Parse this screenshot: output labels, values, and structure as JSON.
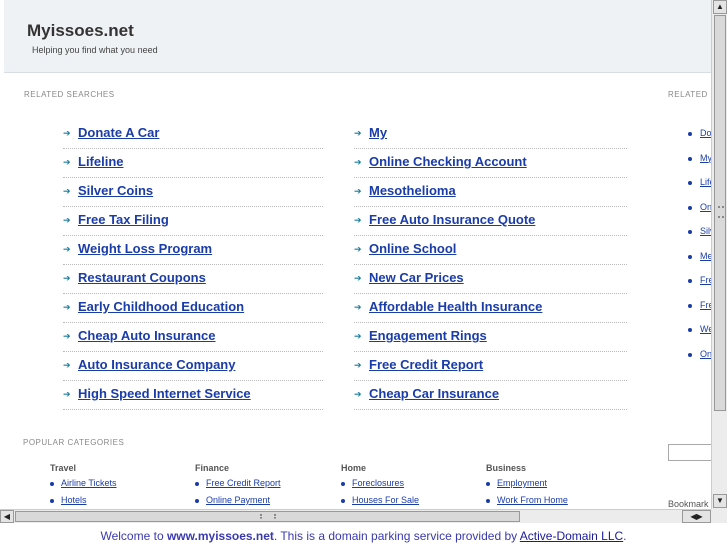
{
  "header": {
    "title": "Myissoes.net",
    "tagline": "Helping you find what you need"
  },
  "related": {
    "heading": "RELATED SEARCHES",
    "left": [
      "Donate A Car",
      "Lifeline",
      "Silver Coins",
      "Free Tax Filing",
      "Weight Loss Program",
      "Restaurant Coupons",
      "Early Childhood Education",
      "Cheap Auto Insurance",
      "Auto Insurance Company",
      "High Speed Internet Service"
    ],
    "right": [
      "My",
      "Online Checking Account",
      "Mesothelioma",
      "Free Auto Insurance Quote",
      "Online School",
      "New Car Prices",
      "Affordable Health Insurance",
      "Engagement Rings",
      "Free Credit Report",
      "Cheap Car Insurance"
    ]
  },
  "sidebar": {
    "heading": "RELATED",
    "items": [
      "Do",
      "My",
      "Life",
      "On",
      "Silv",
      "Me",
      "Fre",
      "Fre",
      "We",
      "On"
    ],
    "bookmark": "Bookmark"
  },
  "popular": {
    "heading": "POPULAR CATEGORIES",
    "columns": [
      {
        "title": "Travel",
        "links": [
          "Airline Tickets",
          "Hotels"
        ]
      },
      {
        "title": "Finance",
        "links": [
          "Free Credit Report",
          "Online Payment"
        ]
      },
      {
        "title": "Home",
        "links": [
          "Foreclosures",
          "Houses For Sale"
        ]
      },
      {
        "title": "Business",
        "links": [
          "Employment",
          "Work From Home"
        ]
      }
    ]
  },
  "footer": {
    "prefix": "Welcome to ",
    "domain": "www.myissoes.net",
    "middle": ". This is a domain parking service provided by ",
    "provider": "Active-Domain LLC",
    "suffix": "."
  },
  "icons": {
    "list_arrow": "arrow-right-icon",
    "scroll_up": "scroll-up-icon",
    "scroll_down": "scroll-down-icon",
    "scroll_left": "scroll-left-icon",
    "scroll_right": "scroll-right-icon"
  },
  "colors": {
    "header_bg": "#eef2f4",
    "link": "#1a3ca8",
    "arrow": "#1a7ca0"
  }
}
